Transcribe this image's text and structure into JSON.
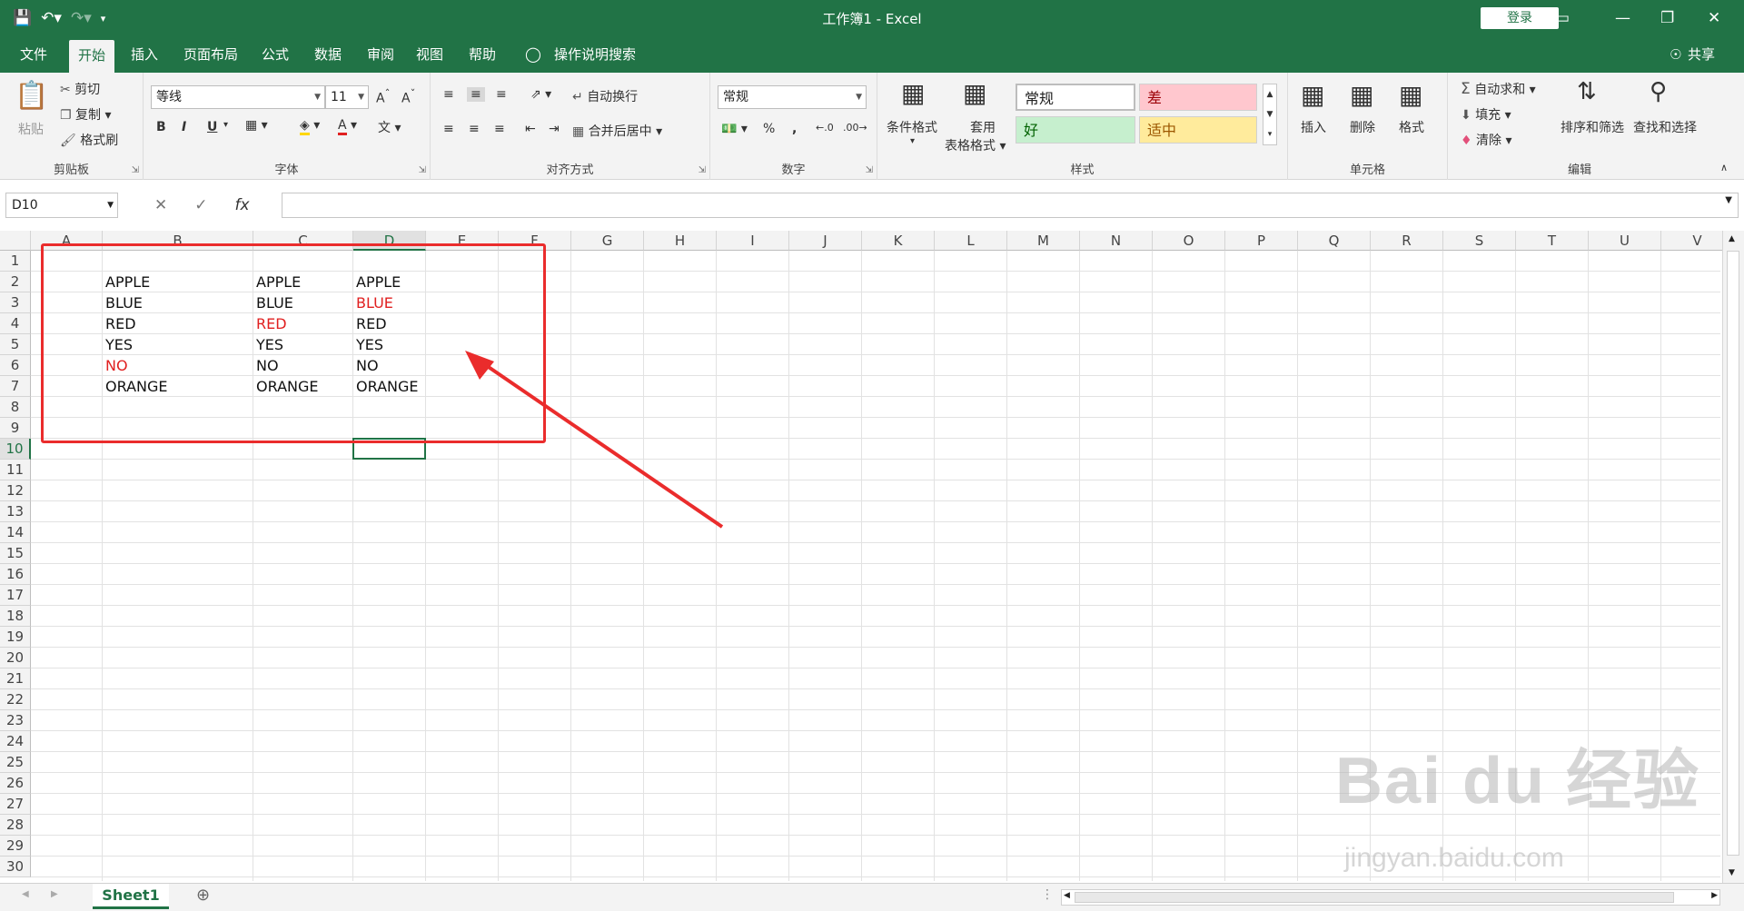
{
  "titlebar": {
    "title": "工作簿1 - Excel",
    "login": "登录"
  },
  "tabs": [
    "文件",
    "开始",
    "插入",
    "页面布局",
    "公式",
    "数据",
    "审阅",
    "视图",
    "帮助"
  ],
  "tellme": "操作说明搜索",
  "share": "共享",
  "clipboard": {
    "paste": "粘贴",
    "cut": "剪切",
    "copy": "复制",
    "format_painter": "格式刷",
    "label": "剪贴板"
  },
  "font": {
    "name": "等线",
    "size": "11",
    "label": "字体",
    "bold": "B",
    "italic": "I",
    "underline": "U"
  },
  "alignment": {
    "wrap": "自动换行",
    "merge": "合并后居中",
    "label": "对齐方式"
  },
  "number": {
    "format": "常规",
    "label": "数字",
    "percent": "%",
    "comma": ","
  },
  "styles": {
    "cond_format": "条件格式",
    "table_format_1": "套用",
    "table_format_2": "表格格式",
    "normal": "常规",
    "bad": "差",
    "good": "好",
    "neutral": "适中",
    "label": "样式"
  },
  "cells": {
    "insert": "插入",
    "delete": "删除",
    "format": "格式",
    "label": "单元格"
  },
  "editing": {
    "autosum": "自动求和",
    "fill": "填充",
    "clear": "清除",
    "sort": "排序和筛选",
    "find": "查找和选择",
    "label": "编辑"
  },
  "formula_bar": {
    "name_box": "D10",
    "fx": "fx"
  },
  "columns": [
    "A",
    "B",
    "C",
    "D",
    "E",
    "F",
    "G",
    "H",
    "I",
    "J",
    "K",
    "L",
    "M",
    "N",
    "O",
    "P",
    "Q",
    "R",
    "S",
    "T",
    "U",
    "V"
  ],
  "rows": [
    "1",
    "2",
    "3",
    "4",
    "5",
    "6",
    "7",
    "8",
    "9",
    "10",
    "11",
    "12",
    "13",
    "14",
    "15",
    "16",
    "17",
    "18",
    "19",
    "20",
    "21",
    "22",
    "23",
    "24",
    "25",
    "26",
    "27",
    "28",
    "29",
    "30"
  ],
  "cells_data": [
    {
      "col": "B",
      "row": 2,
      "text": "APPLE",
      "red": false
    },
    {
      "col": "C",
      "row": 2,
      "text": "APPLE",
      "red": false
    },
    {
      "col": "D",
      "row": 2,
      "text": "APPLE",
      "red": false
    },
    {
      "col": "B",
      "row": 3,
      "text": "BLUE",
      "red": false
    },
    {
      "col": "C",
      "row": 3,
      "text": "BLUE",
      "red": false
    },
    {
      "col": "D",
      "row": 3,
      "text": "BLUE",
      "red": true
    },
    {
      "col": "B",
      "row": 4,
      "text": "RED",
      "red": false
    },
    {
      "col": "C",
      "row": 4,
      "text": "RED",
      "red": true
    },
    {
      "col": "D",
      "row": 4,
      "text": "RED",
      "red": false
    },
    {
      "col": "B",
      "row": 5,
      "text": "YES",
      "red": false
    },
    {
      "col": "C",
      "row": 5,
      "text": "YES",
      "red": false
    },
    {
      "col": "D",
      "row": 5,
      "text": "YES",
      "red": false
    },
    {
      "col": "B",
      "row": 6,
      "text": "NO",
      "red": true
    },
    {
      "col": "C",
      "row": 6,
      "text": "NO",
      "red": false
    },
    {
      "col": "D",
      "row": 6,
      "text": "NO",
      "red": false
    },
    {
      "col": "B",
      "row": 7,
      "text": "ORANGE",
      "red": false
    },
    {
      "col": "C",
      "row": 7,
      "text": "ORANGE",
      "red": false
    },
    {
      "col": "D",
      "row": 7,
      "text": "ORANGE",
      "red": false
    }
  ],
  "selected_cell": "D10",
  "sheet": {
    "name": "Sheet1"
  },
  "watermark": {
    "line1": "Bai du 经验",
    "line2": "jingyan.baidu.com"
  },
  "colors": {
    "excel_green": "#217346",
    "highlight_red": "#e02020",
    "annotation_red": "#ea2c2c"
  }
}
